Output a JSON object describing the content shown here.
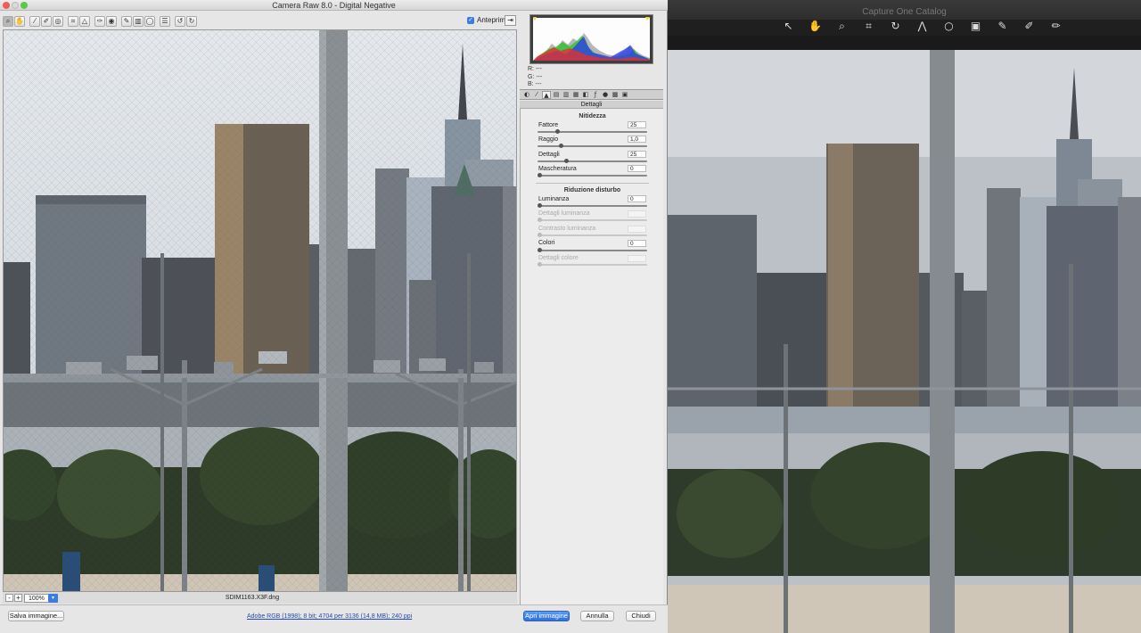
{
  "camera_raw": {
    "window_title": "Camera Raw 8.0  -  Digital Negative",
    "toolbar": {
      "tools": [
        "zoom-icon",
        "hand-icon",
        "white-balance-icon",
        "color-sampler-icon",
        "target-adjust-icon",
        "crop-icon",
        "straighten-icon",
        "spot-removal-icon",
        "red-eye-icon",
        "adjustment-brush-icon",
        "graduated-filter-icon",
        "radial-filter-icon",
        "preferences-icon",
        "rotate-left-icon",
        "rotate-right-icon"
      ],
      "preview_label": "Anteprima",
      "preview_checked": true
    },
    "status": {
      "zoom_value": "100%",
      "filename": "SDIM1163.X3F.dng"
    },
    "rgb_readout": {
      "r": "R:  ---",
      "g": "G:  ---",
      "b": "B:  ---"
    },
    "panel": {
      "title": "Dettagli",
      "sharpening_title": "Nitidezza",
      "sharpening": [
        {
          "label": "Fattore",
          "value": "25",
          "fraction": 0.17
        },
        {
          "label": "Raggio",
          "value": "1,0",
          "fraction": 0.2
        },
        {
          "label": "Dettagli",
          "value": "25",
          "fraction": 0.25
        },
        {
          "label": "Mascheratura",
          "value": "0",
          "fraction": 0.0
        }
      ],
      "noise_title": "Riduzione disturbo",
      "noise": [
        {
          "label": "Luminanza",
          "value": "0",
          "fraction": 0.0,
          "enabled": true
        },
        {
          "label": "Dettagli luminanza",
          "value": "",
          "fraction": 0.0,
          "enabled": false
        },
        {
          "label": "Contrasto luminanza",
          "value": "",
          "fraction": 0.0,
          "enabled": false
        },
        {
          "label": "Colori",
          "value": "0",
          "fraction": 0.0,
          "enabled": true
        },
        {
          "label": "Dettagli colore",
          "value": "",
          "fraction": 0.0,
          "enabled": false
        }
      ]
    },
    "bottom": {
      "save_label": "Salva immagine...",
      "workflow_label": "Adobe RGB (1998); 8 bit; 4704 per 3136 (14,8 MB); 240 ppi",
      "open_label": "Apri immagine",
      "cancel_label": "Annulla",
      "done_label": "Chiudi"
    }
  },
  "capture_one": {
    "window_title": "Capture One Catalog",
    "tools": [
      "cursor-icon",
      "pan-icon",
      "loupe-icon",
      "crop-icon",
      "rotate-icon",
      "keystone-icon",
      "spot-icon",
      "grid-icon",
      "picker-icon",
      "brush-icon",
      "eraser-icon"
    ]
  },
  "colors": {
    "accent": "#3b7be4",
    "capture_one_accent": "#e8892e"
  }
}
